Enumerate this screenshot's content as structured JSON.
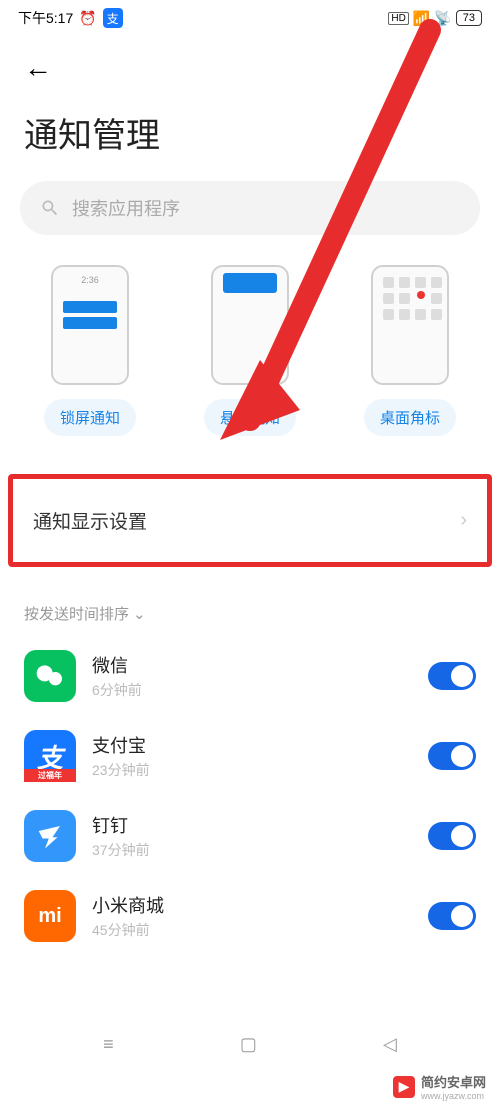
{
  "status": {
    "time": "下午5:17",
    "battery_pct": "73",
    "hd_label": "HD"
  },
  "page_title": "通知管理",
  "search": {
    "placeholder": "搜索应用程序"
  },
  "types": [
    {
      "id": "lock",
      "label": "锁屏通知"
    },
    {
      "id": "float",
      "label": "悬浮通知"
    },
    {
      "id": "badge",
      "label": "桌面角标"
    }
  ],
  "highlight": {
    "label": "通知显示设置"
  },
  "sort_label": "按发送时间排序",
  "apps": [
    {
      "name": "微信",
      "sub": "6分钟前",
      "icon_bg": "#07c160",
      "icon_txt": "●●",
      "toggle": true
    },
    {
      "name": "支付宝",
      "sub": "23分钟前",
      "icon_bg": "#1677ff",
      "icon_txt": "支",
      "toggle": true,
      "banner": "过福年"
    },
    {
      "name": "钉钉",
      "sub": "37分钟前",
      "icon_bg": "#3296fa",
      "icon_txt": "✦",
      "toggle": true
    },
    {
      "name": "小米商城",
      "sub": "45分钟前",
      "icon_bg": "#ff6700",
      "icon_txt": "mi",
      "toggle": true
    }
  ],
  "watermark": {
    "text": "简约安卓网",
    "url": "www.jyazw.com"
  }
}
